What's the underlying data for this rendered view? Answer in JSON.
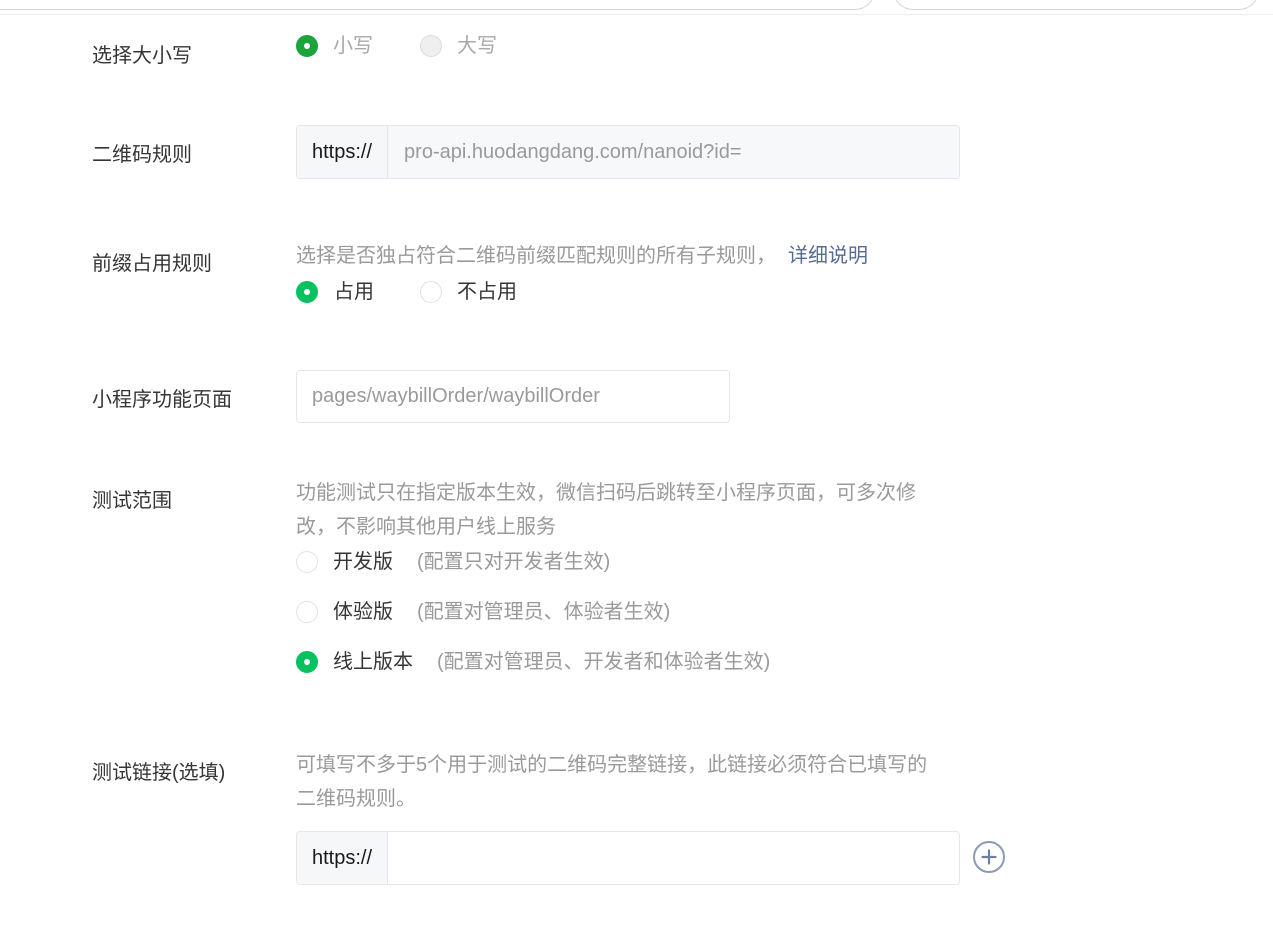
{
  "case": {
    "label": "选择大小写",
    "options": [
      {
        "label": "小写",
        "checked": true
      },
      {
        "label": "大写",
        "checked": false
      }
    ]
  },
  "qr_rule": {
    "label": "二维码规则",
    "prefix": "https://",
    "value": "pro-api.huodangdang.com/nanoid?id="
  },
  "prefix_rule": {
    "label": "前缀占用规则",
    "description": "选择是否独占符合二维码前缀匹配规则的所有子规则，",
    "link": "详细说明",
    "options": [
      {
        "label": "占用",
        "checked": true
      },
      {
        "label": "不占用",
        "checked": false
      }
    ]
  },
  "mini_page": {
    "label": "小程序功能页面",
    "value": "pages/waybillOrder/waybillOrder"
  },
  "test_scope": {
    "label": "测试范围",
    "description_line1": "功能测试只在指定版本生效，微信扫码后跳转至小程序页面，可多次修",
    "description_line2": "改，不影响其他用户线上服务",
    "options": [
      {
        "label": "开发版",
        "hint": "(配置只对开发者生效)",
        "checked": false
      },
      {
        "label": "体验版",
        "hint": "(配置对管理员、体验者生效)",
        "checked": false
      },
      {
        "label": "线上版本",
        "hint": "(配置对管理员、开发者和体验者生效)",
        "checked": true
      }
    ]
  },
  "test_link": {
    "label": "测试链接(选填)",
    "description_line1": "可填写不多于5个用于测试的二维码完整链接，此链接必须符合已填写的",
    "description_line2": "二维码规则。",
    "prefix": "https://",
    "value": ""
  },
  "colors": {
    "accent_green": "#07c160",
    "link_blue": "#576b95",
    "hint_gray": "#9a9a9a"
  }
}
